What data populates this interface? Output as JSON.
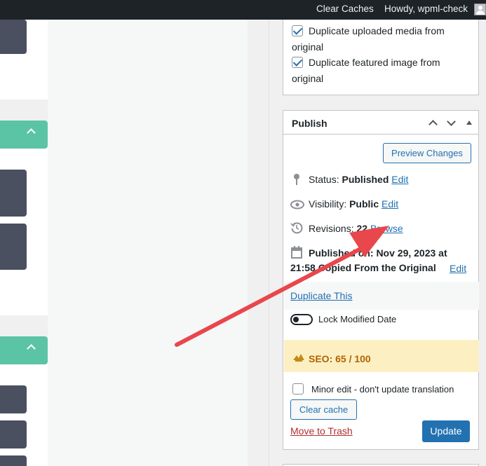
{
  "admin_bar": {
    "clear_caches": "Clear Caches",
    "howdy": "Howdy, wpml-check",
    "avatar_icon": "user-avatar-icon"
  },
  "duplicate_box": {
    "option1": "Duplicate uploaded media from original",
    "option1_checked": true,
    "option2": "Duplicate featured image from original",
    "option2_checked": true
  },
  "publish": {
    "title": "Publish",
    "preview_label": "Preview Changes",
    "status_label": "Status:",
    "status_value": "Published",
    "visibility_label": "Visibility:",
    "visibility_value": "Public",
    "revisions_label": "Revisions:",
    "revisions_value": "22",
    "browse_label": "Browse",
    "published_line1": "Published on: Nov 29, 2023 at",
    "published_line2": "21:58 Copied From the Original",
    "edit_label": "Edit",
    "duplicate_label": "Duplicate This",
    "lock_label": "Lock Modified Date",
    "seo_label": "SEO: 65 / 100",
    "minor_edit_label": "Minor edit - don't update translation",
    "clear_cache_label": "Clear cache",
    "trash_label": "Move to Trash",
    "update_label": "Update"
  },
  "colors": {
    "admin_bar": "#1d2327",
    "link": "#2271b1",
    "accent_green": "#5bc4a5",
    "arrow_red": "#e8474c",
    "seo_bg": "#fcf0c3",
    "trash_red": "#b32d2e"
  }
}
